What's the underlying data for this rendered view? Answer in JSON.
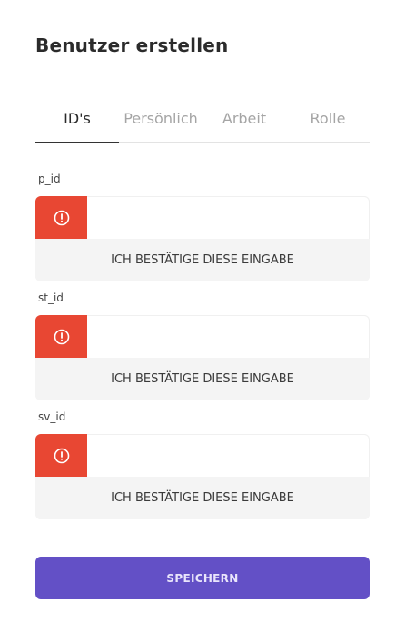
{
  "page_title": "Benutzer erstellen",
  "tabs": [
    {
      "label": "ID's",
      "active": true
    },
    {
      "label": "Persönlich",
      "active": false
    },
    {
      "label": "Arbeit",
      "active": false
    },
    {
      "label": "Rolle",
      "active": false
    }
  ],
  "fields": [
    {
      "label": "p_id",
      "value": "",
      "confirm_label": "ICH BESTÄTIGE DIESE EINGABE",
      "status_icon": "error-circle-icon"
    },
    {
      "label": "st_id",
      "value": "",
      "confirm_label": "ICH BESTÄTIGE DIESE EINGABE",
      "status_icon": "error-circle-icon"
    },
    {
      "label": "sv_id",
      "value": "",
      "confirm_label": "ICH BESTÄTIGE DIESE EINGABE",
      "status_icon": "error-circle-icon"
    }
  ],
  "save_label": "SPEICHERN",
  "colors": {
    "accent": "#6350c6",
    "error": "#e84733",
    "tab_active": "#2b2b2b",
    "tab_inactive": "#a5a5a5"
  }
}
